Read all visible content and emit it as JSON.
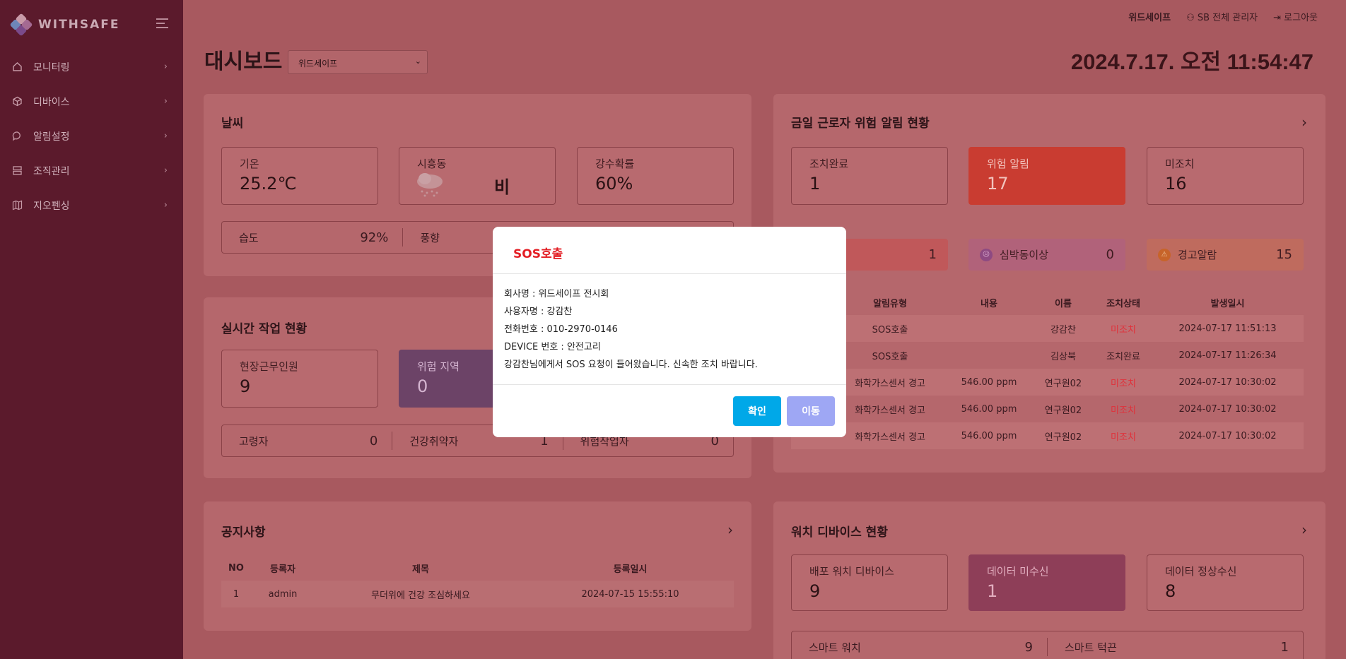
{
  "brand": {
    "logo_text": "WITHSAFE"
  },
  "sidebar": {
    "items": [
      {
        "label": "모니터링",
        "icon": "home-icon"
      },
      {
        "label": "디바이스",
        "icon": "box-icon"
      },
      {
        "label": "알림설정",
        "icon": "chat-icon"
      },
      {
        "label": "조직관리",
        "icon": "server-icon"
      },
      {
        "label": "지오펜싱",
        "icon": "map-icon"
      }
    ]
  },
  "topbar": {
    "company": "위드세이프",
    "user": "SB 전체 관리자",
    "logout": "로그아웃"
  },
  "header": {
    "title": "대시보드",
    "company_select": "위드세이프",
    "datetime": "2024.7.17. 오전 11:54:47"
  },
  "weather": {
    "title": "날씨",
    "temp_label": "기온",
    "temp_value": "25.2℃",
    "location_label": "시흥동",
    "condition": "비",
    "rain_label": "강수확률",
    "rain_value": "60%",
    "humidity_label": "습도",
    "humidity_value": "92%",
    "wind_label": "풍향"
  },
  "work": {
    "title": "실시간 작업 현황",
    "onsite_label": "현장근무인원",
    "onsite_value": "9",
    "danger_label": "위험 지역",
    "danger_value": "0",
    "elderly_label": "고령자",
    "elderly_value": "0",
    "health_label": "건강취약자",
    "health_value": "1",
    "hazard_label": "위험작업자",
    "hazard_value": "0"
  },
  "notice": {
    "title": "공지사항",
    "columns": [
      "NO",
      "등록자",
      "제목",
      "등록일시"
    ],
    "rows": [
      [
        "1",
        "admin",
        "무더위에 건강 조심하세요",
        "2024-07-15 15:55:10"
      ]
    ]
  },
  "alerts": {
    "title": "금일 근로자 위험 알림 현황",
    "done_label": "조치완료",
    "done_value": "1",
    "danger_label": "위험 알림",
    "danger_value": "17",
    "pending_label": "미조치",
    "pending_value": "16",
    "sos_value": "1",
    "heart_label": "심박동이상",
    "heart_value": "0",
    "warn_label": "경고알람",
    "warn_value": "15",
    "columns": [
      "알림유형",
      "내용",
      "이름",
      "조치상태",
      "발생일시"
    ],
    "rows": [
      [
        "SOS호출",
        "",
        "강감찬",
        "미조치",
        "2024-07-17 11:51:13"
      ],
      [
        "SOS호출",
        "",
        "김상북",
        "조치완료",
        "2024-07-17 11:26:34"
      ],
      [
        "화학가스센서 경고",
        "546.00 ppm",
        "연구원02",
        "미조치",
        "2024-07-17 10:30:02"
      ],
      [
        "화학가스센서 경고",
        "546.00 ppm",
        "연구원02",
        "미조치",
        "2024-07-17 10:30:02"
      ],
      [
        "화학가스센서 경고",
        "546.00 ppm",
        "연구원02",
        "미조치",
        "2024-07-17 10:30:02"
      ]
    ]
  },
  "watch": {
    "title": "워치 디바이스 현황",
    "deployed_label": "배포 워치 디바이스",
    "deployed_value": "9",
    "missing_label": "데이터 미수신",
    "missing_value": "1",
    "normal_label": "데이터 정상수신",
    "normal_value": "8",
    "smartwatch_label": "스마트 워치",
    "smartwatch_value": "9",
    "smartchin_label": "스마트 턱끈",
    "smartchin_value": "1"
  },
  "modal": {
    "title": "SOS호출",
    "lines": [
      "회사명 : 위드세이프 전시회",
      "사용자명 : 강감찬",
      "전화번호 : 010-2970-0146",
      "DEVICE 번호 : 안전고리",
      "강감찬님에게서 SOS 요청이 들어왔습니다. 신속한 조치 바랍니다."
    ],
    "confirm_label": "확인",
    "move_label": "이동"
  }
}
